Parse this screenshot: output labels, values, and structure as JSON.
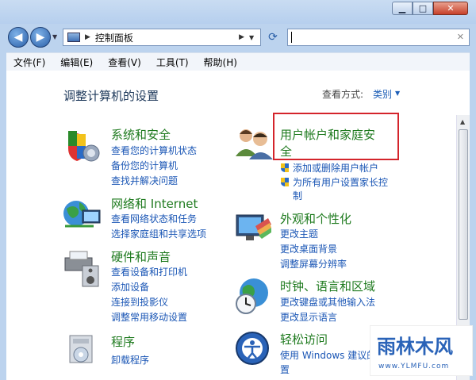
{
  "window": {
    "caption": {
      "minimize": "▁",
      "maximize": "□",
      "close": "✕"
    }
  },
  "nav": {
    "back_icon": "back-arrow-icon",
    "forward_icon": "forward-arrow-icon",
    "address_crumb": "控制面板",
    "address_sep": "▶",
    "search_placeholder": ""
  },
  "menubar": [
    "文件(F)",
    "编辑(E)",
    "查看(V)",
    "工具(T)",
    "帮助(H)"
  ],
  "page": {
    "heading": "调整计算机的设置",
    "view_by_label": "查看方式:",
    "view_by_value": "类别"
  },
  "categories": {
    "system": {
      "title": "系统和安全",
      "links": [
        "查看您的计算机状态",
        "备份您的计算机",
        "查找并解决问题"
      ]
    },
    "network": {
      "title": "网络和 Internet",
      "links": [
        "查看网络状态和任务",
        "选择家庭组和共享选项"
      ]
    },
    "hardware": {
      "title": "硬件和声音",
      "links": [
        "查看设备和打印机",
        "添加设备",
        "连接到投影仪",
        "调整常用移动设置"
      ]
    },
    "programs": {
      "title": "程序",
      "links": [
        "卸载程序"
      ]
    },
    "users": {
      "title_line1": "用户帐户和家庭安",
      "title_line2": "全",
      "links": [
        "添加或删除用户帐户",
        "为所有用户设置家长控",
        "制"
      ]
    },
    "appearance": {
      "title": "外观和个性化",
      "links": [
        "更改主题",
        "更改桌面背景",
        "调整屏幕分辨率"
      ]
    },
    "clock": {
      "title": "时钟、语言和区域",
      "links": [
        "更改键盘或其他输入法",
        "更改显示语言"
      ]
    },
    "ease": {
      "title": "轻松访问",
      "links": [
        "使用 Windows 建议的",
        "置"
      ]
    }
  },
  "watermark": {
    "brand": "雨林木风",
    "url": "www.YLMFU.com"
  },
  "colors": {
    "accent_link": "#1a56b5",
    "category_green": "#1e7a1e",
    "highlight_red": "#d4242b"
  }
}
